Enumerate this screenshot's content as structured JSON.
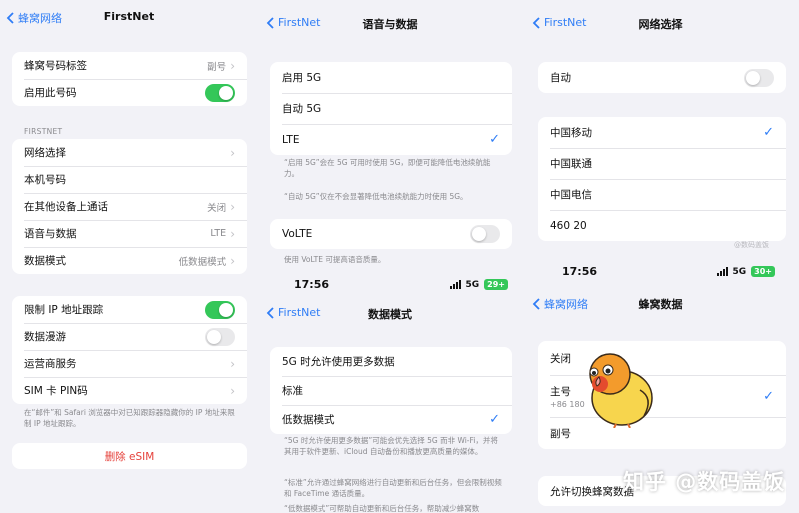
{
  "panel1": {
    "back_label": "蜂窝网络",
    "title": "FirstNet",
    "group1": [
      {
        "label": "蜂窝号码标签",
        "value": "副号"
      },
      {
        "label": "启用此号码",
        "toggle": "on"
      }
    ],
    "section_header": "FIRSTNET",
    "group2": [
      {
        "label": "网络选择",
        "value": ""
      },
      {
        "label": "本机号码",
        "value": ""
      },
      {
        "label": "在其他设备上通话",
        "value": "关闭"
      },
      {
        "label": "语音与数据",
        "value": "LTE"
      },
      {
        "label": "数据模式",
        "value": "低数据模式"
      }
    ],
    "group3": [
      {
        "label": "限制 IP 地址跟踪",
        "toggle": "on"
      },
      {
        "label": "数据漫游",
        "toggle": "off"
      },
      {
        "label": "运营商服务",
        "value": ""
      },
      {
        "label": "SIM 卡 PIN码",
        "value": ""
      }
    ],
    "footnote": "在“邮件”和 Safari 浏览器中对已知跟踪器隐藏你的 IP 地址来限制 IP 地址跟踪。",
    "delete_label": "删除 eSIM"
  },
  "panel2": {
    "back_label": "FirstNet",
    "title": "语音与数据",
    "options": [
      {
        "label": "启用 5G",
        "checked": false
      },
      {
        "label": "自动 5G",
        "checked": false
      },
      {
        "label": "LTE",
        "checked": true
      }
    ],
    "note1": "“启用 5G”会在 5G 可用时使用 5G，即便可能降低电池续航能力。",
    "note2": "“自动 5G”仅在不会显著降低电池续航能力时使用 5G。",
    "volte_label": "VoLTE",
    "volte_toggle": "off",
    "volte_note": "使用 VoLTE 可提高语音质量。",
    "status": {
      "time": "17:56",
      "network": "5G",
      "battery": "29+"
    },
    "data_mode": {
      "back_label": "FirstNet",
      "title": "数据模式",
      "options": [
        {
          "label": "5G 时允许使用更多数据",
          "checked": false
        },
        {
          "label": "标准",
          "checked": false
        },
        {
          "label": "低数据模式",
          "checked": true
        }
      ],
      "note1": "“5G 时允许使用更多数据”可能会优先选择 5G 而非 Wi-Fi，并将其用于软件更新、iCloud 自动备份和播放更高质量的媒体。",
      "note2": "“标准”允许通过蜂窝网络进行自动更新和后台任务，但会限制视频和 FaceTime 通话质量。",
      "note3": "“低数据模式”可帮助自动更新和后台任务，帮助减少蜂窝数"
    }
  },
  "panel3": {
    "back_label": "FirstNet",
    "title": "网络选择",
    "auto_label": "自动",
    "auto_toggle": "off",
    "carriers": [
      {
        "label": "中国移动",
        "checked": true
      },
      {
        "label": "中国联通",
        "checked": false
      },
      {
        "label": "中国电信",
        "checked": false
      },
      {
        "label": "460 20",
        "checked": false
      }
    ],
    "status": {
      "time": "17:56",
      "network": "5G",
      "battery": "30+"
    },
    "cellular": {
      "back_label": "蜂窝网络",
      "title": "蜂窝数据",
      "options": [
        {
          "label": "关闭",
          "sub": "",
          "checked": false
        },
        {
          "label": "主号",
          "sub": "+86 180",
          "checked": true
        },
        {
          "label": "副号",
          "sub": "",
          "checked": false
        }
      ],
      "switch_label": "允许切换蜂窝数据"
    }
  },
  "watermark": "知乎 @数码盖饭",
  "watermark_small": "@数码盖饭",
  "colors": {
    "accent": "#2f7df6",
    "toggle_on": "#34c759",
    "danger": "#e5403a",
    "background": "#f2f2f7"
  }
}
